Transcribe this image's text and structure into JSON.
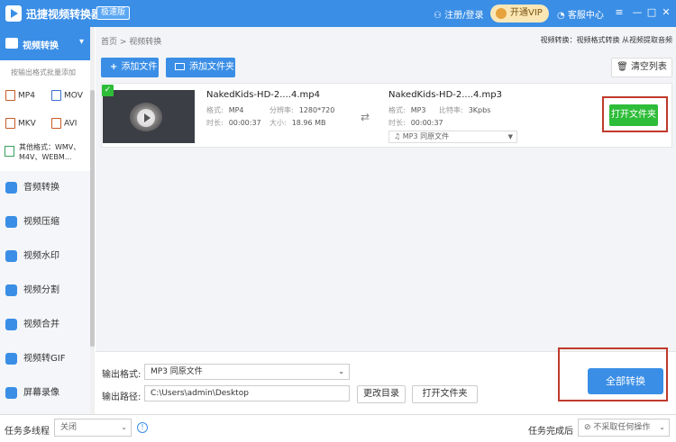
{
  "titlebar": {
    "app_title": "迅捷视频转换器",
    "badge": "极速版",
    "register": "注册/登录",
    "vip": "开通VIP",
    "service": "客服中心",
    "menu_icon": "≡",
    "min_icon": "—",
    "max_icon": "□",
    "close_icon": "✕"
  },
  "sidebar": {
    "active": "视频转换",
    "hint": "按输出格式批量添加",
    "formats": [
      "MP4",
      "MOV",
      "MKV",
      "AVI"
    ],
    "other_formats": "其他格式：WMV、M4V、WEBM...",
    "items": [
      "音频转换",
      "视频压缩",
      "视频水印",
      "视频分割",
      "视频合并",
      "视频转GIF",
      "屏幕录像"
    ]
  },
  "main": {
    "crumb": "首页 > 视频转换",
    "tip": "视频转换：视频格式转换 从视频提取音频",
    "add_file": "添加文件",
    "add_folder": "添加文件夹",
    "clear": "清空列表",
    "file": {
      "src_name": "NakedKids-HD-2....4.mp4",
      "fmt_label": "格式:",
      "src_fmt": "MP4",
      "res_label": "分辨率:",
      "res": "1280*720",
      "dur_label": "时长:",
      "src_dur": "00:00:37",
      "size_label": "大小:",
      "size": "18.96 MB",
      "dst_name": "NakedKids-HD-2....4.mp3",
      "dst_fmt": "MP3",
      "rate_label": "比特率:",
      "rate": "3Kpbs",
      "dst_dur": "00:00:37",
      "dst_select": "♫ MP3  同原文件",
      "open_folder": "打开文件夹"
    }
  },
  "bottom": {
    "out_fmt_label": "输出格式:",
    "out_fmt": "MP3  同原文件",
    "out_path_label": "输出路径:",
    "out_path": "C:\\Users\\admin\\Desktop",
    "change_dir": "更改目录",
    "open_folder": "打开文件夹",
    "convert_all": "全部转换"
  },
  "status": {
    "multithread_label": "任务多线程",
    "multithread_value": "关闭",
    "done_label": "任务完成后",
    "done_value": "⊘ 不采取任何操作"
  },
  "colors": {
    "accent": "#3a8ee6",
    "green": "#2ebd39",
    "highlight": "#c0392b"
  }
}
